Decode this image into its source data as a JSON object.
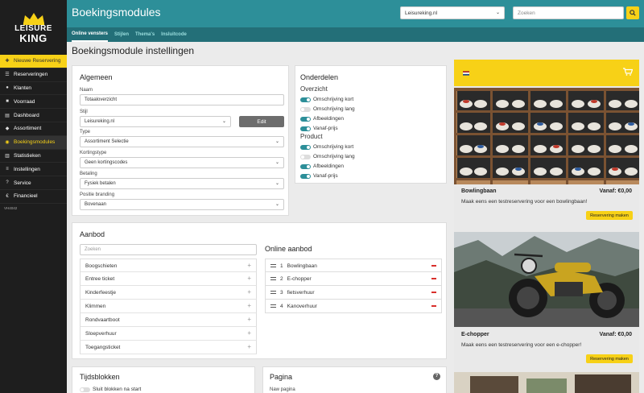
{
  "brand": {
    "logo_line1": "LEISURE",
    "logo_line2": "KING"
  },
  "sidebar": {
    "items": [
      {
        "label": "Nieuwe Reservering",
        "icon": "plus-icon"
      },
      {
        "label": "Reserveringen",
        "icon": "list-icon"
      },
      {
        "label": "Klanten",
        "icon": "users-icon"
      },
      {
        "label": "Voorraad",
        "icon": "box-icon"
      },
      {
        "label": "Dashboard",
        "icon": "chart-icon"
      },
      {
        "label": "Assortiment",
        "icon": "tag-icon"
      },
      {
        "label": "Boekingsmodules",
        "icon": "globe-icon"
      },
      {
        "label": "Statistieken",
        "icon": "stats-icon"
      },
      {
        "label": "Instellingen",
        "icon": "sliders-icon"
      },
      {
        "label": "Service",
        "icon": "help-icon"
      },
      {
        "label": "Financieel",
        "icon": "euro-icon"
      }
    ],
    "version": "VH4042"
  },
  "header": {
    "title": "Boekingsmodules",
    "site_select": "Leisureking.nl",
    "search_placeholder": "Zoeken"
  },
  "subtabs": [
    "Online vensters",
    "Stijlen",
    "Thema's",
    "Insluitcode"
  ],
  "page_title": "Boekingsmodule instellingen",
  "algemeen": {
    "title": "Algemeen",
    "naam_label": "Naam",
    "naam_value": "Totaaloverzicht",
    "stijl_label": "Stijl",
    "stijl_value": "Leisureking.nl",
    "edit_label": "Edit",
    "type_label": "Type",
    "type_value": "Assortiment Selectie",
    "kortingstype_label": "Kortingstype",
    "kortingstype_value": "Geen kortingscodes",
    "betaling_label": "Betaling",
    "betaling_value": "Fysiek betalen",
    "positie_label": "Positie branding",
    "positie_value": "Bovenaan"
  },
  "onderdelen": {
    "title": "Onderdelen",
    "overzicht_label": "Overzicht",
    "product_label": "Product",
    "overzicht": [
      {
        "label": "Omschrijving kort",
        "on": true
      },
      {
        "label": "Omschrijving lang",
        "on": false
      },
      {
        "label": "Afbeeldingen",
        "on": true
      },
      {
        "label": "Vanaf-prijs",
        "on": true
      }
    ],
    "product": [
      {
        "label": "Omschrijving kort",
        "on": true
      },
      {
        "label": "Omschrijving lang",
        "on": false
      },
      {
        "label": "Afbeeldingen",
        "on": true
      },
      {
        "label": "Vanaf-prijs",
        "on": true
      }
    ]
  },
  "aanbod": {
    "title": "Aanbod",
    "search_placeholder": "Zoeken",
    "items": [
      "Boogschieten",
      "Entree ticket",
      "Kinderfeestje",
      "Klimmen",
      "Rondvaartboot",
      "Sloepverhuur",
      "Toegangsticket"
    ],
    "online_title": "Online aanbod",
    "online": [
      {
        "num": "1",
        "label": "Bowlingbaan"
      },
      {
        "num": "2",
        "label": "E-chopper"
      },
      {
        "num": "3",
        "label": "fietsverhuur"
      },
      {
        "num": "4",
        "label": "Kanoverhuur"
      }
    ]
  },
  "tijdsblokken": {
    "title": "Tijdsblokken",
    "toggle_label": "Sluit blokken na start"
  },
  "pagina": {
    "title": "Pagina",
    "field_label": "Naw pagina"
  },
  "preview": {
    "products": [
      {
        "name": "Bowlingbaan",
        "price": "Vanaf: €0,00",
        "desc": "Maak eens een testreservering voor een bowlingbaan!",
        "button": "Reservering maken"
      },
      {
        "name": "E-chopper",
        "price": "Vanaf: €0,00",
        "desc": "Maak eens een testreservering voor een e-chopper!",
        "button": "Reservering maken"
      }
    ]
  },
  "colors": {
    "accent": "#f7d117",
    "teal": "#2d8f99",
    "danger": "#d9302c"
  }
}
